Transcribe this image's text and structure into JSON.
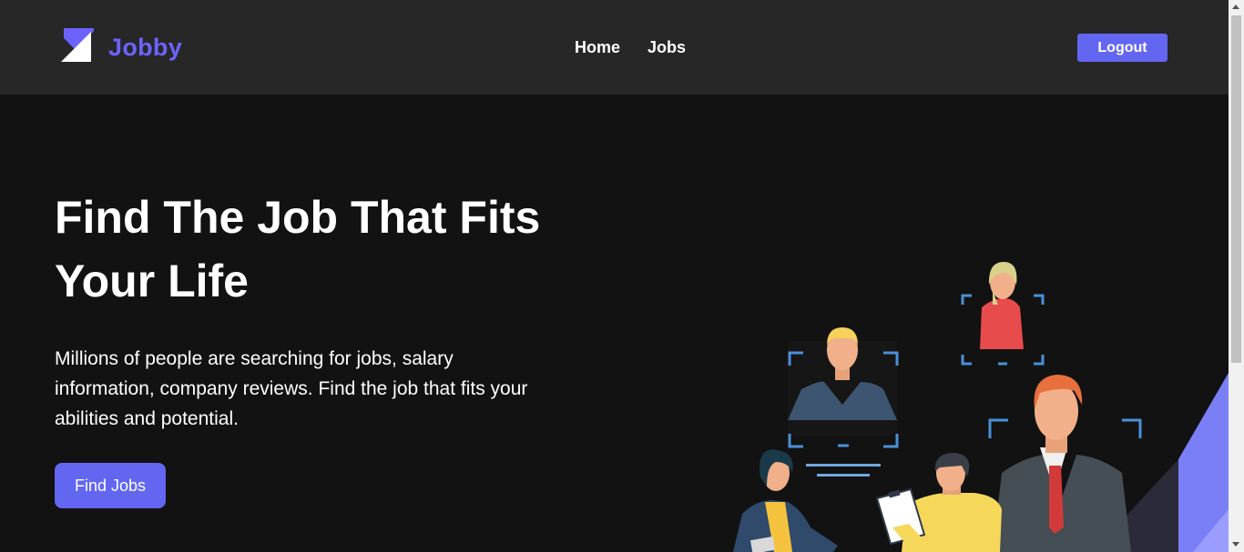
{
  "header": {
    "logo_text": "Jobby",
    "nav_links": [
      "Home",
      "Jobs"
    ],
    "logout_label": "Logout"
  },
  "hero": {
    "title_line1": "Find The Job That Fits",
    "title_line2": "Your Life",
    "description": "Millions of people are searching for jobs, salary information, company reviews. Find the job that fits your abilities and potential.",
    "cta_label": "Find Jobs"
  },
  "colors": {
    "accent": "#6366f1",
    "brand_text": "#6c63ff",
    "header_bg": "#272727",
    "page_bg": "#121212"
  },
  "icons": {
    "logo": "jobby-logo-icon",
    "illustration": "job-search-illustration"
  }
}
